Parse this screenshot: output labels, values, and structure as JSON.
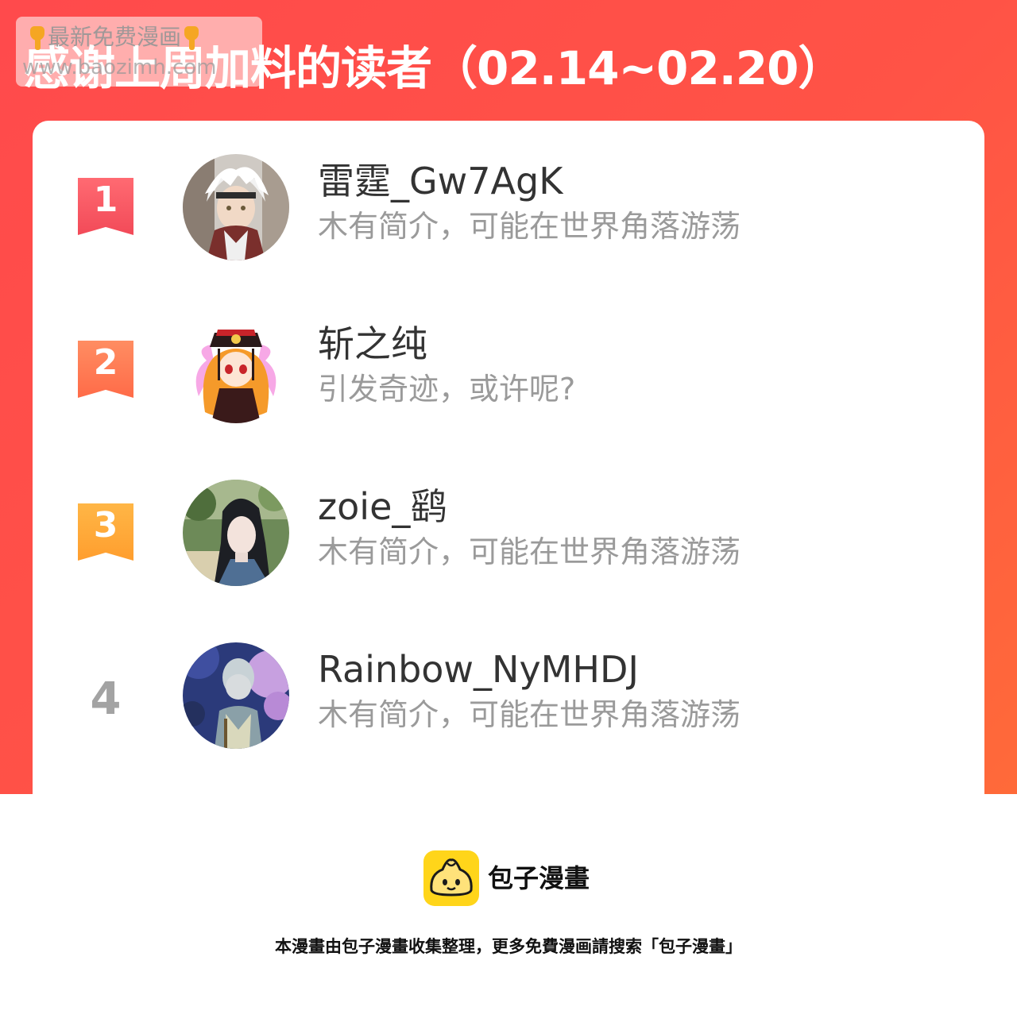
{
  "header": {
    "title": "感谢上周加料的读者（02.14~02.20）",
    "watermark_line1": "最新免费漫画",
    "watermark_line2": "www.baozimh.com"
  },
  "colors": {
    "banner": "#ff4f47",
    "rank1": "#f6525e",
    "rank2": "#ff7a52",
    "rank3": "#ffa83a",
    "rank_plain": "#a3a3a3",
    "logo": "#ffd51a"
  },
  "readers": [
    {
      "rank": "1",
      "name": "雷霆_Gw7AgK",
      "bio": "木有简介，可能在世界角落游荡"
    },
    {
      "rank": "2",
      "name": "斩之纯",
      "bio": "引发奇迹，或许呢?"
    },
    {
      "rank": "3",
      "name": "zoie_鹞",
      "bio": "木有简介，可能在世界角落游荡"
    },
    {
      "rank": "4",
      "name": "Rainbow_NyMHDJ",
      "bio": "木有简介，可能在世界角落游荡"
    }
  ],
  "footer": {
    "brand": "包子漫畫",
    "note": "本漫畫由包子漫畫收集整理，更多免費漫画請搜索「包子漫畫」",
    "logo_icon": "bun-mascot-icon"
  }
}
